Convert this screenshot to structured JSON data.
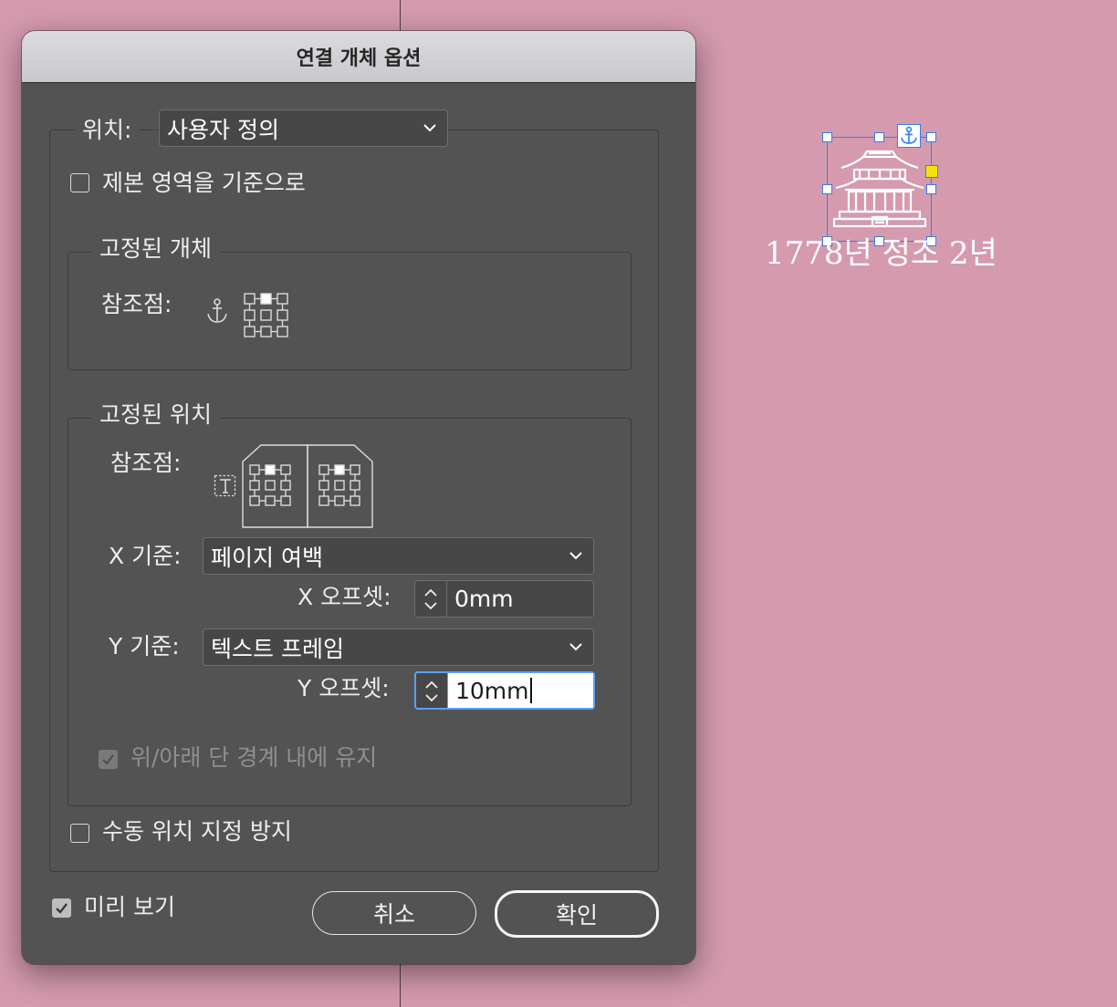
{
  "dialog": {
    "title": "연결 개체 옵션",
    "position_label": "위치:",
    "position_value": "사용자 정의",
    "relative_to_spine_label": "제본 영역을 기준으로",
    "relative_to_spine_checked": false,
    "anchored_object": {
      "legend": "고정된 개체",
      "reference_point_label": "참조점:"
    },
    "anchored_position": {
      "legend": "고정된 위치",
      "reference_point_label": "참조점:",
      "x_relative_label": "X 기준:",
      "x_relative_value": "페이지 여백",
      "x_offset_label": "X 오프셋:",
      "x_offset_value": "0mm",
      "y_relative_label": "Y 기준:",
      "y_relative_value": "텍스트 프레임",
      "y_offset_label": "Y 오프셋:",
      "y_offset_value": "10mm",
      "keep_within_label": "위/아래 단 경계 내에 유지",
      "keep_within_checked": true,
      "keep_within_enabled": false
    },
    "prevent_manual_label": "수동 위치 지정 방지",
    "prevent_manual_checked": false,
    "preview_label": "미리 보기",
    "preview_checked": true,
    "cancel_label": "취소",
    "ok_label": "확인"
  },
  "canvas": {
    "caption": "1778년 정조 2년",
    "selection_color": "#2f7ff0",
    "handle_accent_color": "#f5e400",
    "background_color": "#d59aae"
  }
}
